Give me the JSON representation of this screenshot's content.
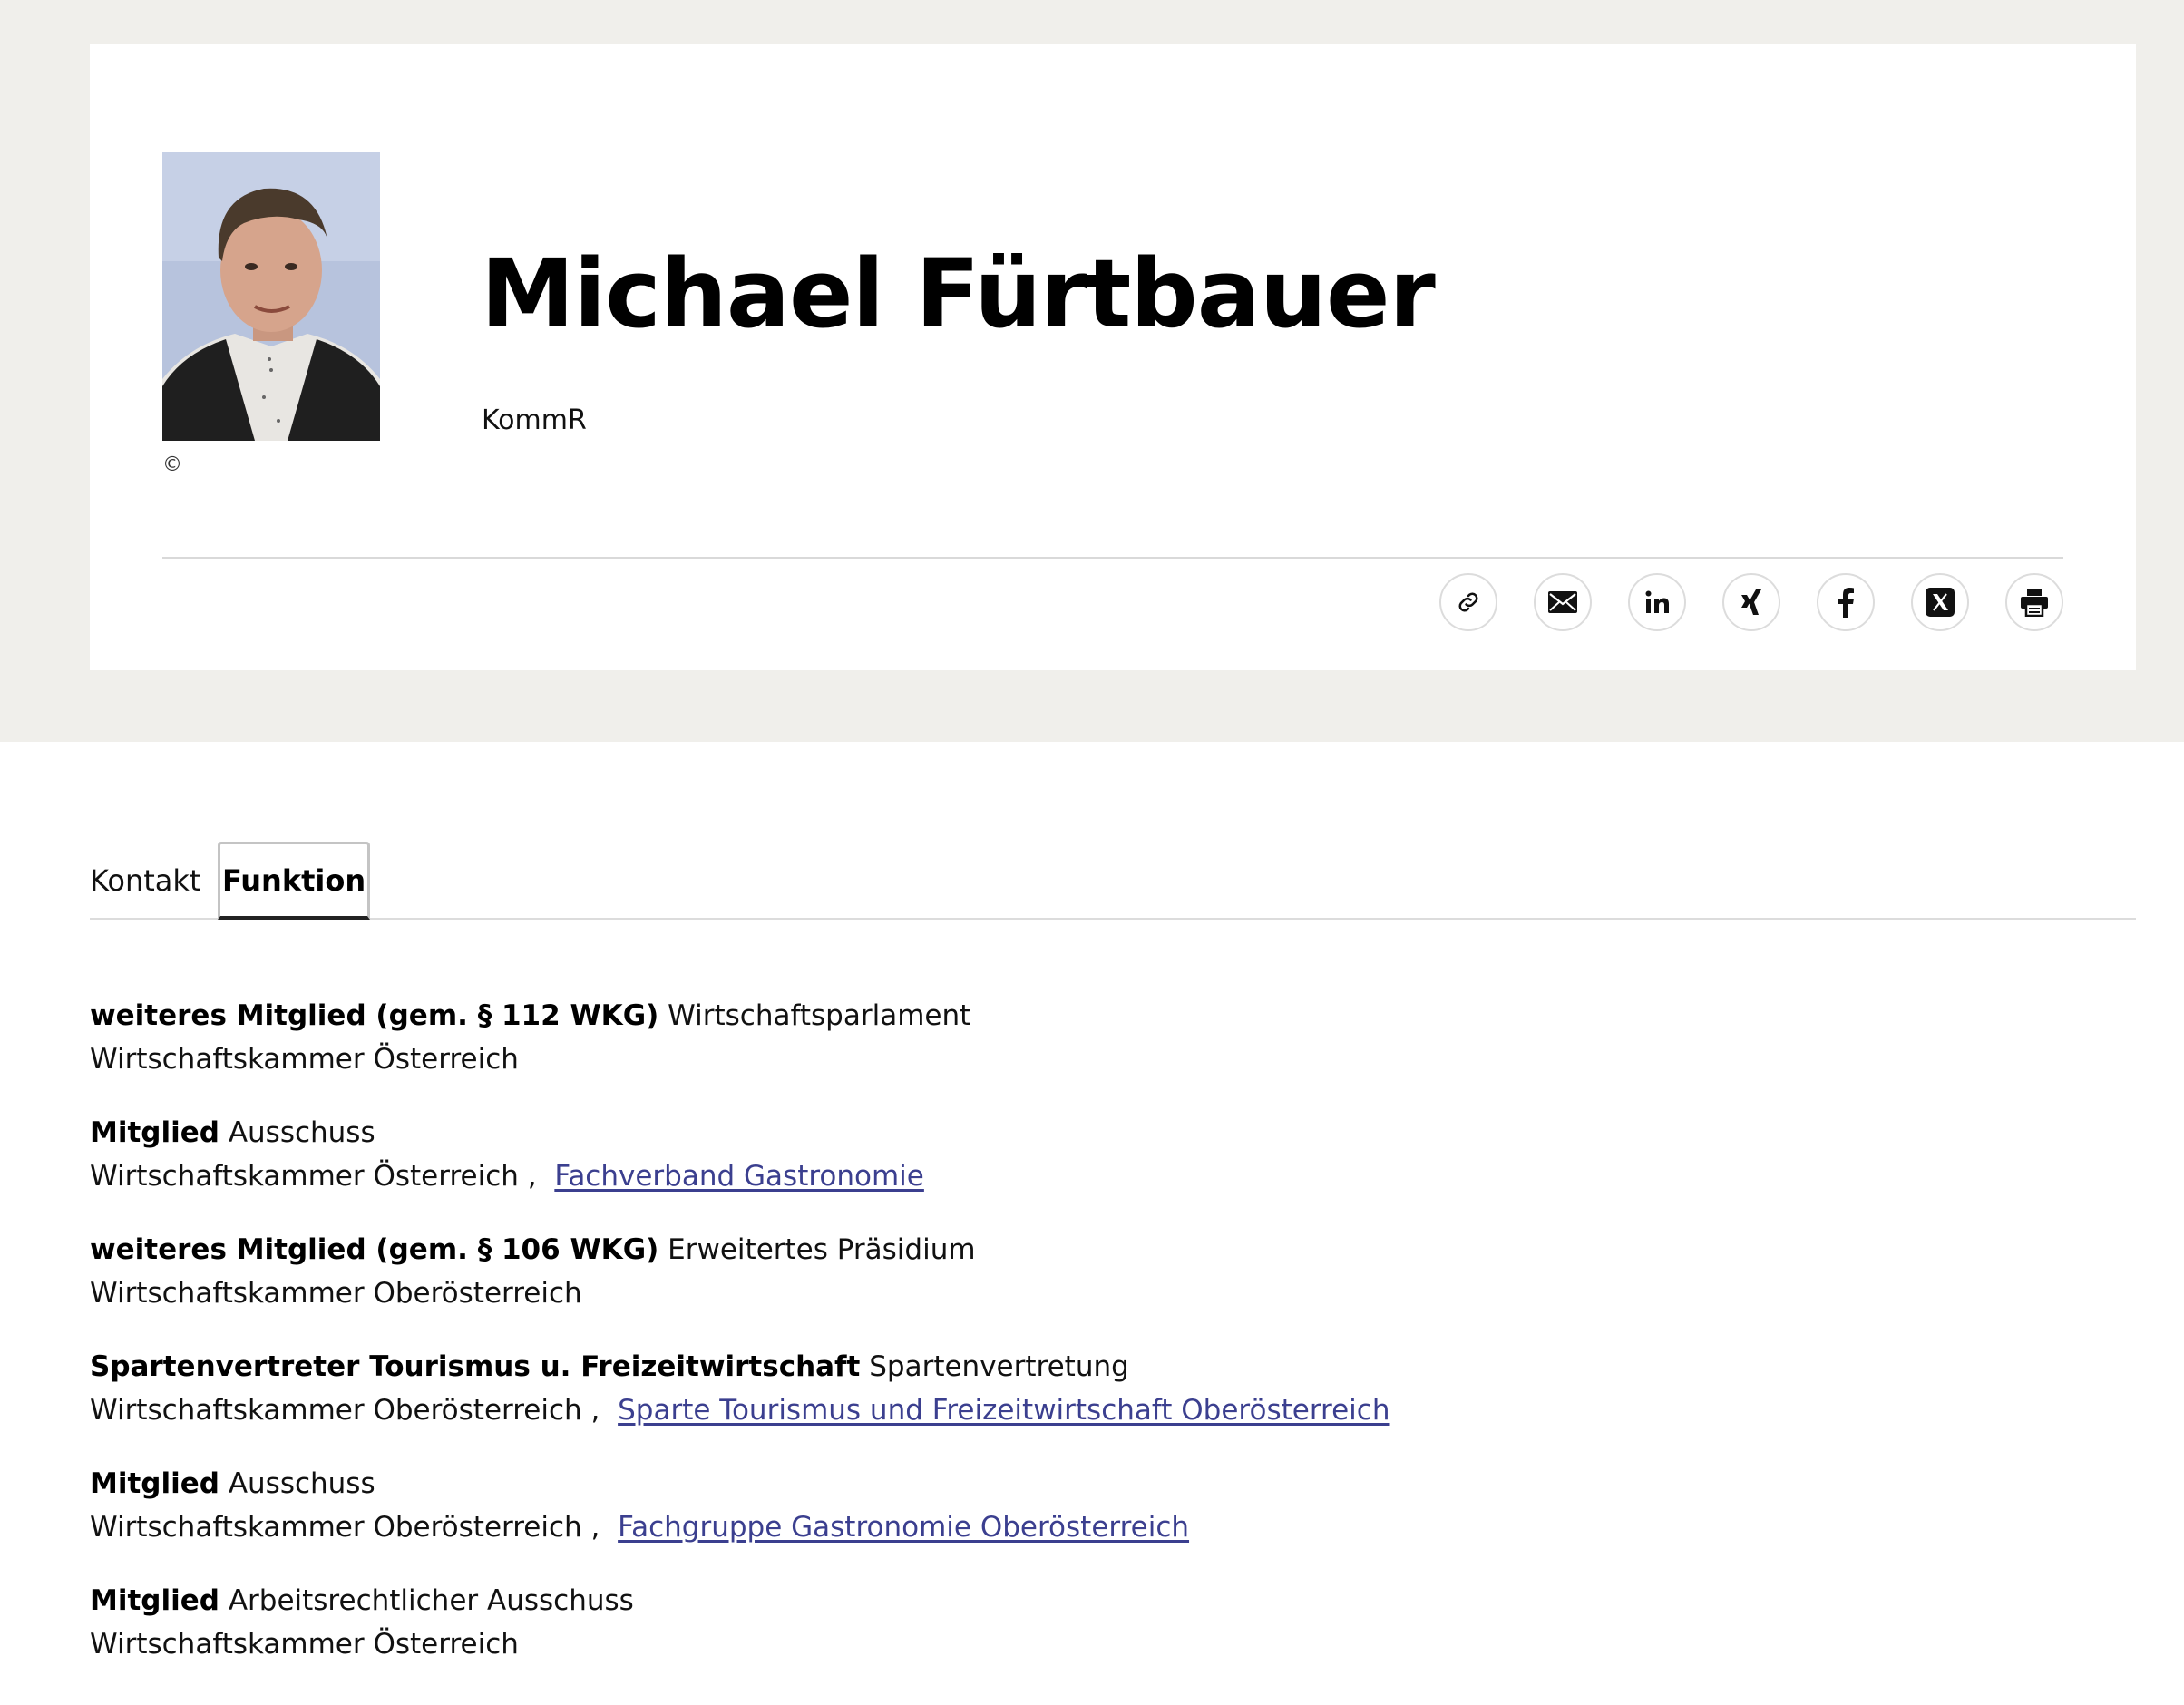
{
  "profile": {
    "name": "Michael Fürtbauer",
    "title": "KommR",
    "copyright": "©",
    "photo_icon": "portrait-photo"
  },
  "share_icons": [
    {
      "name": "link-icon",
      "label": "Link kopieren"
    },
    {
      "name": "mail-icon",
      "label": "E-Mail"
    },
    {
      "name": "linkedin-icon",
      "label": "LinkedIn"
    },
    {
      "name": "xing-icon",
      "label": "Xing"
    },
    {
      "name": "facebook-icon",
      "label": "Facebook"
    },
    {
      "name": "x-icon",
      "label": "X"
    },
    {
      "name": "print-icon",
      "label": "Drucken"
    }
  ],
  "tabs": [
    {
      "label": "Kontakt",
      "active": false
    },
    {
      "label": "Funktion",
      "active": true
    }
  ],
  "functions": [
    {
      "role": "weiteres Mitglied (gem. § 112 WKG)",
      "body": "Wirtschaftsparlament",
      "organization": "Wirtschaftskammer Österreich",
      "separator": "",
      "link": ""
    },
    {
      "role": "Mitglied",
      "body": "Ausschuss",
      "organization": "Wirtschaftskammer Österreich",
      "separator": " ,",
      "link": "Fachverband Gastronomie"
    },
    {
      "role": "weiteres Mitglied (gem. § 106 WKG)",
      "body": "Erweitertes Präsidium",
      "organization": "Wirtschaftskammer Oberösterreich",
      "separator": "",
      "link": ""
    },
    {
      "role": "Spartenvertreter Tourismus u. Freizeitwirtschaft",
      "body": "Spartenvertretung",
      "organization": "Wirtschaftskammer Oberösterreich",
      "separator": " ,",
      "link": "Sparte Tourismus und Freizeitwirtschaft Oberösterreich"
    },
    {
      "role": "Mitglied",
      "body": "Ausschuss",
      "organization": "Wirtschaftskammer Oberösterreich",
      "separator": " ,",
      "link": "Fachgruppe Gastronomie Oberösterreich"
    },
    {
      "role": "Mitglied",
      "body": "Arbeitsrechtlicher Ausschuss",
      "organization": "Wirtschaftskammer Österreich",
      "separator": "",
      "link": ""
    }
  ],
  "colors": {
    "page_band": "#f0efeb",
    "link": "#3b3f8f"
  }
}
